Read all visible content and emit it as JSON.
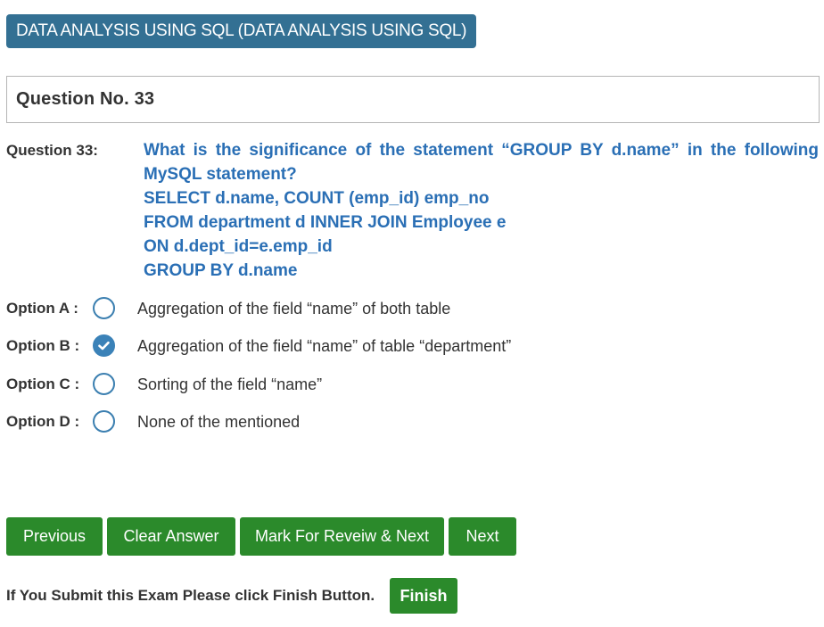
{
  "subject": {
    "title": "DATA ANALYSIS USING SQL (DATA ANALYSIS USING SQL)"
  },
  "question_header": {
    "label": "Question No. 33"
  },
  "question": {
    "label": "Question 33:",
    "lines": [
      "What is the significance of the statement “GROUP BY d.name” in the following",
      "MySQL statement?",
      "SELECT d.name, COUNT (emp_id) emp_no",
      "FROM department d INNER JOIN Employee e",
      "ON d.dept_id=e.emp_id",
      "GROUP BY d.name"
    ]
  },
  "options": [
    {
      "label": "Option A :",
      "text": "Aggregation of the field “name” of both table",
      "selected": false
    },
    {
      "label": "Option B :",
      "text": "Aggregation of the field “name” of table “department”",
      "selected": true
    },
    {
      "label": "Option C :",
      "text": "Sorting of the field “name”",
      "selected": false
    },
    {
      "label": "Option D :",
      "text": "None of the mentioned",
      "selected": false
    }
  ],
  "buttons": {
    "previous": "Previous",
    "clear": "Clear Answer",
    "mark_review": "Mark For Reveiw & Next",
    "next": "Next"
  },
  "finish": {
    "prompt": "If You Submit this Exam Please click Finish Button.",
    "button": "Finish"
  },
  "colors": {
    "subject_bg": "#337093",
    "question_text": "#2a6fb5",
    "button_green": "#2b8a2b",
    "radio_blue": "#3b82b8"
  }
}
